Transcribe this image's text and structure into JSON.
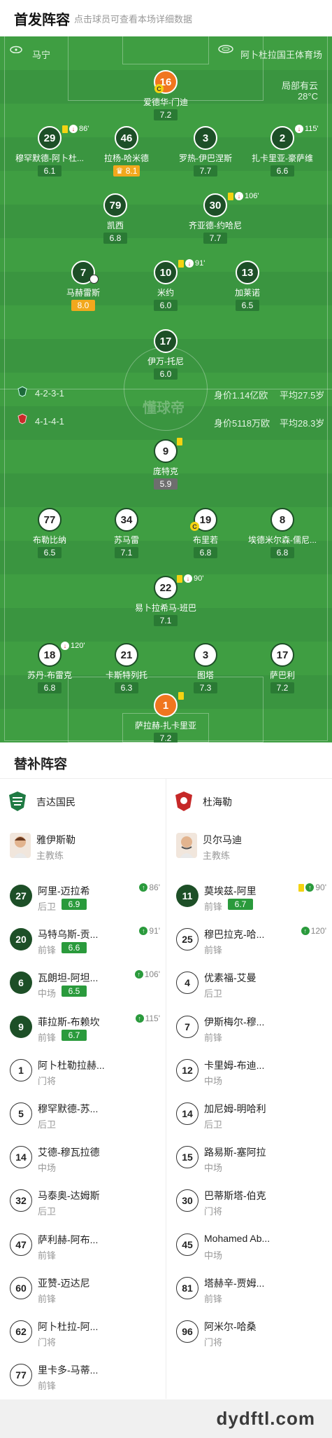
{
  "header": {
    "title": "首发阵容",
    "subtitle": "点击球员可查看本场详细数据"
  },
  "pitch_info": {
    "referee": "马宁",
    "venue": "阿卜杜拉国王体育场",
    "weather": "局部有云",
    "temp": "28°C",
    "watermark": "懂球帝"
  },
  "home_team": {
    "formation": "4-2-3-1",
    "value": "身价1.14亿欧",
    "age": "平均27.5岁"
  },
  "away_team": {
    "formation": "4-1-4-1",
    "value": "身价5118万欧",
    "age": "平均28.3岁"
  },
  "home_players": [
    {
      "num": "16",
      "name": "爱德华-门迪",
      "rating": "7.2"
    },
    {
      "num": "29",
      "name": "穆罕默德-阿卜杜...",
      "rating": "6.1",
      "event": "86'"
    },
    {
      "num": "46",
      "name": "拉杨-哈米德",
      "rating": "8.1"
    },
    {
      "num": "3",
      "name": "罗热-伊巴涅斯",
      "rating": "7.7"
    },
    {
      "num": "2",
      "name": "扎卡里亚-豪萨维",
      "rating": "6.6",
      "event": "115'"
    },
    {
      "num": "79",
      "name": "凯西",
      "rating": "6.8"
    },
    {
      "num": "30",
      "name": "齐亚德-约哈尼",
      "rating": "7.7",
      "event": "106'"
    },
    {
      "num": "7",
      "name": "马赫雷斯",
      "rating": "8.0"
    },
    {
      "num": "10",
      "name": "米约",
      "rating": "6.0",
      "event": "91'"
    },
    {
      "num": "13",
      "name": "加莱诺",
      "rating": "6.5"
    },
    {
      "num": "17",
      "name": "伊万-托尼",
      "rating": "6.0"
    }
  ],
  "away_players": [
    {
      "num": "9",
      "name": "庞特克",
      "rating": "5.9"
    },
    {
      "num": "77",
      "name": "布勒比纳",
      "rating": "6.5"
    },
    {
      "num": "34",
      "name": "苏马雷",
      "rating": "7.1"
    },
    {
      "num": "19",
      "name": "布里若",
      "rating": "6.8"
    },
    {
      "num": "8",
      "name": "埃德米尔森-儒尼...",
      "rating": "6.8"
    },
    {
      "num": "22",
      "name": "易卜拉希马-班巴",
      "rating": "7.1",
      "event": "90'"
    },
    {
      "num": "18",
      "name": "苏丹-布雷克",
      "rating": "6.8",
      "event": "120'"
    },
    {
      "num": "21",
      "name": "卡斯特列托",
      "rating": "6.3"
    },
    {
      "num": "3",
      "name": "图塔",
      "rating": "7.3"
    },
    {
      "num": "17",
      "name": "萨巴利",
      "rating": "7.2"
    },
    {
      "num": "1",
      "name": "萨拉赫-扎卡里亚",
      "rating": "7.2"
    }
  ],
  "subs": {
    "title": "替补阵容",
    "home": {
      "team": "吉达国民",
      "coach": "雅伊斯勒",
      "coach_role": "主教练",
      "players": [
        {
          "num": "27",
          "name": "阿里-迈拉希",
          "pos": "后卫",
          "rating": "6.9",
          "event": "86'"
        },
        {
          "num": "20",
          "name": "马特乌斯-贡...",
          "pos": "前锋",
          "rating": "6.6",
          "event": "91'"
        },
        {
          "num": "6",
          "name": "瓦朗坦-阿坦...",
          "pos": "中场",
          "rating": "6.5",
          "event": "106'"
        },
        {
          "num": "9",
          "name": "菲拉斯-布赖坎",
          "pos": "前锋",
          "rating": "6.7",
          "event": "115'"
        },
        {
          "num": "1",
          "name": "阿卜杜勒拉赫...",
          "pos": "门将"
        },
        {
          "num": "5",
          "name": "穆罕默德-苏...",
          "pos": "后卫"
        },
        {
          "num": "14",
          "name": "艾德-穆瓦拉德",
          "pos": "中场"
        },
        {
          "num": "32",
          "name": "马泰奥-达姆斯",
          "pos": "后卫"
        },
        {
          "num": "47",
          "name": "萨利赫-阿布...",
          "pos": "前锋"
        },
        {
          "num": "60",
          "name": "亚赞-迈达尼",
          "pos": "前锋"
        },
        {
          "num": "62",
          "name": "阿卜杜拉-阿...",
          "pos": "门将"
        },
        {
          "num": "77",
          "name": "里卡多-马蒂...",
          "pos": "前锋"
        }
      ]
    },
    "away": {
      "team": "杜海勒",
      "coach": "贝尔马迪",
      "coach_role": "主教练",
      "players": [
        {
          "num": "11",
          "name": "莫埃兹-阿里",
          "pos": "前锋",
          "rating": "6.7",
          "event": "90'"
        },
        {
          "num": "25",
          "name": "穆巴拉克-哈...",
          "pos": "前锋",
          "event": "120'"
        },
        {
          "num": "4",
          "name": "优素福-艾曼",
          "pos": "后卫"
        },
        {
          "num": "7",
          "name": "伊斯梅尔-穆...",
          "pos": "前锋"
        },
        {
          "num": "12",
          "name": "卡里姆-布迪...",
          "pos": "中场"
        },
        {
          "num": "14",
          "name": "加尼姆-明哈利",
          "pos": "后卫"
        },
        {
          "num": "15",
          "name": "路易斯-塞阿拉",
          "pos": "中场"
        },
        {
          "num": "30",
          "name": "巴蒂斯塔-伯克",
          "pos": "门将"
        },
        {
          "num": "45",
          "name": "Mohamed Ab...",
          "pos": "中场"
        },
        {
          "num": "81",
          "name": "塔赫辛-贾姆...",
          "pos": "前锋"
        },
        {
          "num": "96",
          "name": "阿米尔-哈桑",
          "pos": "门将"
        }
      ]
    }
  },
  "footer": {
    "watermark": "dydftl.com"
  }
}
